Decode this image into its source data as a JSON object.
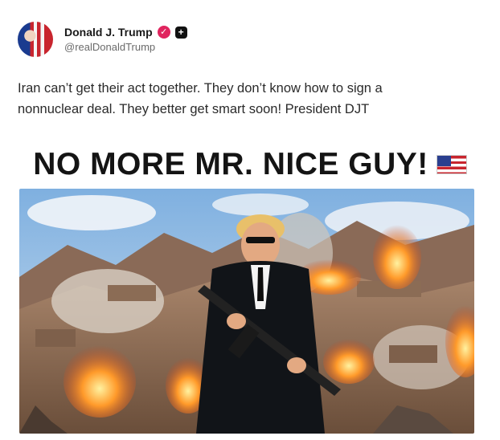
{
  "post": {
    "author": {
      "name": "Donald J. Trump",
      "handle": "@realDonaldTrump",
      "verified_icon": "verified-check-icon",
      "badge_icon": "plus-badge-icon"
    },
    "text_lines": [
      "Iran can’t get their act together. They don’t know how to sign a",
      "nonnuclear deal. They better get smart soon! President DJT"
    ],
    "image": {
      "headline": "NO MORE MR. NICE GUY!",
      "flag_icon": "us-flag-icon"
    }
  },
  "colors": {
    "verified": "#e0245e",
    "headline": "#141414",
    "text": "#2a2a2a",
    "handle": "#6b6b6b"
  }
}
